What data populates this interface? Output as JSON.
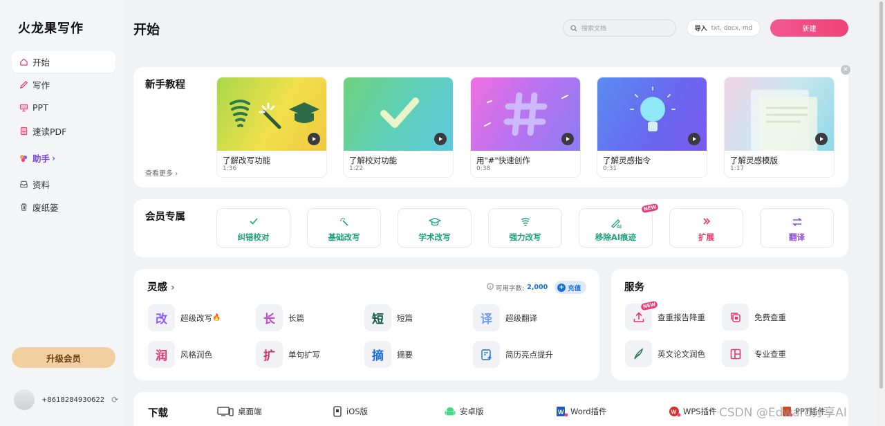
{
  "app": {
    "name": "火龙果写作"
  },
  "sidebar": {
    "items": [
      {
        "label": "开始",
        "icon": "home-icon"
      },
      {
        "label": "写作",
        "icon": "pen-icon"
      },
      {
        "label": "PPT",
        "icon": "presentation-icon"
      },
      {
        "label": "速读PDF",
        "icon": "pdf-icon"
      },
      {
        "label": "助手",
        "icon": "assistant-icon"
      },
      {
        "label": "资料",
        "icon": "inbox-icon"
      },
      {
        "label": "废纸篓",
        "icon": "trash-icon"
      }
    ],
    "assist_chevron": "›",
    "upgrade_label": "升级会员",
    "user_phone": "+8618284930622"
  },
  "header": {
    "title": "开始",
    "search_placeholder": "搜索文档",
    "import_label": "导入",
    "import_formats": "txt, docx, md",
    "new_label": "新建"
  },
  "tutorials": {
    "title": "新手教程",
    "more_label": "查看更多",
    "items": [
      {
        "title": "了解改写功能",
        "duration": "1:36"
      },
      {
        "title": "了解校对功能",
        "duration": "1:22"
      },
      {
        "title": "用\"#\"快速创作",
        "duration": "0:38"
      },
      {
        "title": "了解灵感指令",
        "duration": "0:31"
      },
      {
        "title": "了解灵感模版",
        "duration": "1:17"
      }
    ]
  },
  "vip": {
    "title": "会员专属",
    "items": [
      {
        "label": "纠错校对",
        "color": "#1aa37a"
      },
      {
        "label": "基础改写",
        "color": "#1aa37a"
      },
      {
        "label": "学术改写",
        "color": "#1aa37a"
      },
      {
        "label": "强力改写",
        "color": "#1aa37a"
      },
      {
        "label": "移除AI痕迹",
        "color": "#1aa37a",
        "badge": "NEW"
      },
      {
        "label": "扩展",
        "color": "#e8356d"
      },
      {
        "label": "翻译",
        "color": "#8b4cd9"
      }
    ]
  },
  "inspiration": {
    "title": "灵感",
    "chevron": "›",
    "quota_label": "可用字数:",
    "quota_value": "2,000",
    "recharge_label": "充值",
    "items": [
      {
        "glyph": "改",
        "label": "超级改写",
        "color": "#8a5cf0",
        "suffix": "🔥"
      },
      {
        "glyph": "长",
        "label": "长篇",
        "color": "#c045c9"
      },
      {
        "glyph": "短",
        "label": "短篇",
        "color": "#0f5a44"
      },
      {
        "glyph": "译",
        "label": "超级翻译",
        "color": "#6f9ff0"
      },
      {
        "glyph": "润",
        "label": "风格润色",
        "color": "#e8356d"
      },
      {
        "glyph": "扩",
        "label": "单句扩写",
        "color": "#c7345f"
      },
      {
        "glyph": "摘",
        "label": "摘要",
        "color": "#1b6fd8"
      },
      {
        "glyph": "",
        "label": "简历亮点提升",
        "color": "#1b6fd8"
      }
    ]
  },
  "services": {
    "title": "服务",
    "items": [
      {
        "label": "查重报告降重",
        "badge": "NEW"
      },
      {
        "label": "免费查重"
      },
      {
        "label": "英文论文润色"
      },
      {
        "label": "专业查重"
      }
    ]
  },
  "downloads": {
    "title": "下载",
    "items": [
      {
        "label": "桌面端"
      },
      {
        "label": "iOS版"
      },
      {
        "label": "安卓版"
      },
      {
        "label": "Word插件"
      },
      {
        "label": "WPS插件"
      },
      {
        "label": "PPT插件"
      }
    ]
  },
  "watermark": "CSDN @Edward分享AI"
}
